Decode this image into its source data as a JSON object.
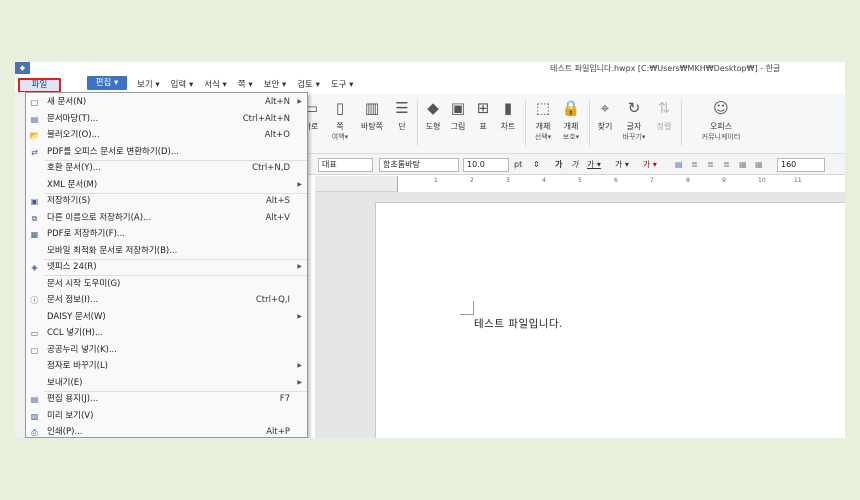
{
  "window": {
    "title": "테스트 파일입니다.hwpx [C:₩Users₩MKH₩Desktop₩] - 한글"
  },
  "menubar": {
    "file": "파일",
    "edit": "편집 ▾",
    "items": [
      "보기 ▾",
      "입력 ▾",
      "서식 ▾",
      "쪽 ▾",
      "보안 ▾",
      "검토 ▾",
      "도구 ▾"
    ]
  },
  "ribbon": {
    "margin": "가로",
    "page_margin": "쪽",
    "page_margin_sub": "여백▾",
    "background": "바탕쪽",
    "columns": "단",
    "shape": "도형",
    "picture": "그림",
    "table": "표",
    "chart": "차트",
    "object_select": "개체",
    "object_select_sub": "선택▾",
    "object_protect": "개체",
    "object_protect_sub": "보호▾",
    "find": "찾기",
    "char_change": "글자",
    "char_change_sub": "바꾸기▾",
    "sort": "정렬",
    "office": "오피스",
    "office_sub": "커뮤니케이터"
  },
  "format_bar": {
    "style": "대표",
    "font": "함초롬바탕",
    "size": "10.0",
    "unit": "pt",
    "zoom": "160"
  },
  "ruler": {
    "ticks": [
      "1",
      "2",
      "3",
      "4",
      "5",
      "6",
      "7",
      "8",
      "9",
      "10",
      "11"
    ]
  },
  "document": {
    "text": "테스트 파일입니다."
  },
  "file_menu": {
    "items": [
      {
        "icon": "□",
        "label": "새 문서(N)",
        "shortcut": "Alt+N",
        "submenu": true
      },
      {
        "icon": "▤",
        "label": "문서마당(T)...",
        "shortcut": "Ctrl+Alt+N",
        "submenu": false
      },
      {
        "icon": "📂",
        "label": "불러오기(O)...",
        "shortcut": "Alt+O",
        "submenu": false
      },
      {
        "icon": "⇄",
        "label": "PDF를 오피스 문서로 변환하기(D)...",
        "shortcut": "",
        "submenu": false
      },
      {
        "icon": "",
        "label": "호환 문서(Y)...",
        "shortcut": "Ctrl+N,D",
        "submenu": false
      },
      {
        "icon": "",
        "label": "XML 문서(M)",
        "shortcut": "",
        "submenu": true
      },
      {
        "icon": "▣",
        "label": "저장하기(S)",
        "shortcut": "Alt+S",
        "submenu": false
      },
      {
        "icon": "⧉",
        "label": "다른 이름으로 저장하기(A)...",
        "shortcut": "Alt+V",
        "submenu": false
      },
      {
        "icon": "▦",
        "label": "PDF로 저장하기(F)...",
        "shortcut": "",
        "submenu": false
      },
      {
        "icon": "",
        "label": "모바일 최적화 문서로 저장하기(B)...",
        "shortcut": "",
        "submenu": false
      },
      {
        "icon": "◈",
        "label": "넷피스 24(R)",
        "shortcut": "",
        "submenu": true
      },
      {
        "icon": "",
        "label": "문서 시작 도우미(G)",
        "shortcut": "",
        "submenu": false
      },
      {
        "icon": "ⓘ",
        "label": "문서 정보(I)...",
        "shortcut": "Ctrl+Q,I",
        "submenu": false
      },
      {
        "icon": "",
        "label": "DAISY 문서(W)",
        "shortcut": "",
        "submenu": true
      },
      {
        "icon": "▭",
        "label": "CCL 넣기(H)...",
        "shortcut": "",
        "submenu": false
      },
      {
        "icon": "▢",
        "label": "공공누리 넣기(K)...",
        "shortcut": "",
        "submenu": false
      },
      {
        "icon": "",
        "label": "점자로 바꾸기(L)",
        "shortcut": "",
        "submenu": true
      },
      {
        "icon": "",
        "label": "보내기(E)",
        "shortcut": "",
        "submenu": true
      },
      {
        "icon": "▤",
        "label": "편집 용지(J)...",
        "shortcut": "F7",
        "submenu": false
      },
      {
        "icon": "▧",
        "label": "미리 보기(V)",
        "shortcut": "",
        "submenu": false
      },
      {
        "icon": "⎙",
        "label": "인쇄(P)...",
        "shortcut": "Alt+P",
        "submenu": false
      }
    ]
  },
  "colors": {
    "highlight_border": "#e02020",
    "edit_tab": "#3b74c7",
    "background": "#e8f0dc"
  }
}
